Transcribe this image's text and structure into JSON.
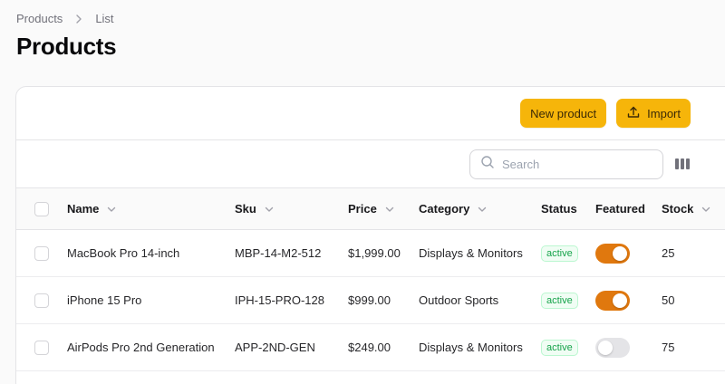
{
  "breadcrumb": {
    "items": [
      "Products",
      "List"
    ]
  },
  "page": {
    "title": "Products"
  },
  "actions": {
    "new_product": "New product",
    "import": "Import"
  },
  "search": {
    "placeholder": "Search"
  },
  "table": {
    "columns": {
      "name": "Name",
      "sku": "Sku",
      "price": "Price",
      "category": "Category",
      "status": "Status",
      "featured": "Featured",
      "stock": "Stock"
    },
    "rows": [
      {
        "name": "MacBook Pro 14-inch",
        "sku": "MBP-14-M2-512",
        "price": "$1,999.00",
        "category": "Displays & Monitors",
        "status": "active",
        "featured": true,
        "stock": "25"
      },
      {
        "name": "iPhone 15 Pro",
        "sku": "IPH-15-PRO-128",
        "price": "$999.00",
        "category": "Outdoor Sports",
        "status": "active",
        "featured": true,
        "stock": "50"
      },
      {
        "name": "AirPods Pro 2nd Generation",
        "sku": "APP-2ND-GEN",
        "price": "$249.00",
        "category": "Displays & Monitors",
        "status": "active",
        "featured": false,
        "stock": "75"
      }
    ]
  },
  "colors": {
    "accent": "#f6b50a",
    "toggle_on": "#e0780e",
    "toggle_off": "#e4e4e7",
    "status_active": "#16a34a"
  },
  "icons": {
    "breadcrumb_separator": "chevron-right-icon",
    "import": "upload-icon",
    "search": "search-icon",
    "columns": "columns-icon",
    "sort": "chevron-down-icon"
  }
}
